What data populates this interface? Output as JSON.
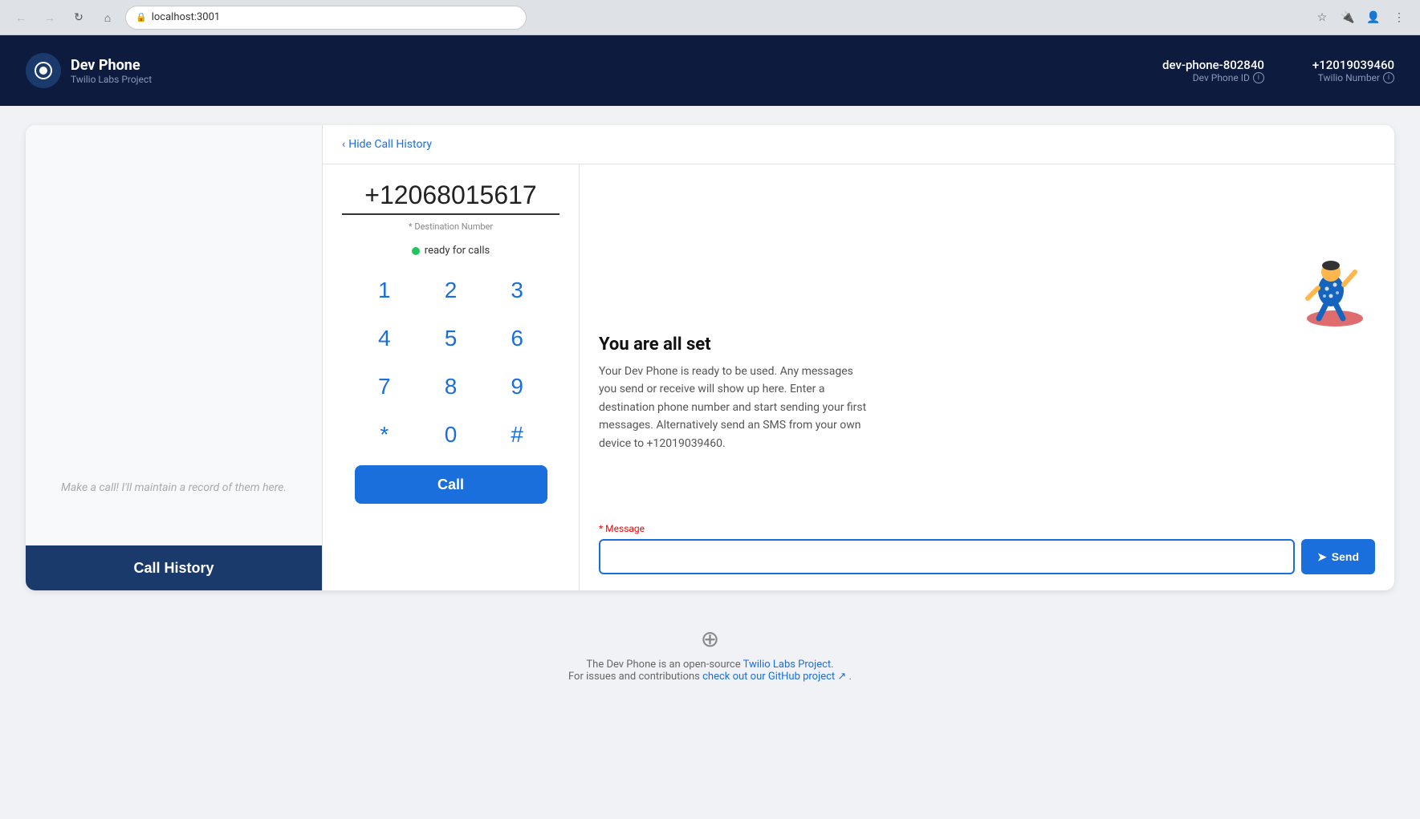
{
  "browser": {
    "url": "localhost:3001",
    "back_disabled": true,
    "forward_disabled": true
  },
  "header": {
    "logo_icon": "📞",
    "app_name": "Dev Phone",
    "subtitle": "Twilio Labs Project",
    "dev_phone_id_label": "Dev Phone ID",
    "dev_phone_id_value": "dev-phone-802840",
    "twilio_number_label": "Twilio Number",
    "twilio_number_value": "+12019039460"
  },
  "left_panel": {
    "placeholder_text": "Make a call! I'll maintain a record of them here.",
    "call_history_button": "Call History"
  },
  "dialer": {
    "phone_number": "+12068015617",
    "destination_label": "* Destination Number",
    "status_text": "ready for calls",
    "keys": [
      "1",
      "2",
      "3",
      "4",
      "5",
      "6",
      "7",
      "8",
      "9",
      "*",
      "0",
      "#"
    ],
    "call_button_label": "Call"
  },
  "messages": {
    "hide_history_label": "Hide Call History",
    "all_set_title": "You are all set",
    "all_set_desc": "Your Dev Phone is ready to be used. Any messages you send or receive will show up here. Enter a destination phone number and start sending your first messages. Alternatively send an SMS from your own device to +12019039460.",
    "message_label": "Message",
    "message_placeholder": "",
    "send_button_label": "Send"
  },
  "footer": {
    "description": "The Dev Phone is an open-source",
    "link1_text": "Twilio Labs Project",
    "link1_url": "#",
    "description2": "For issues and contributions",
    "link2_text": "check out our GitHub project",
    "link2_url": "#"
  }
}
